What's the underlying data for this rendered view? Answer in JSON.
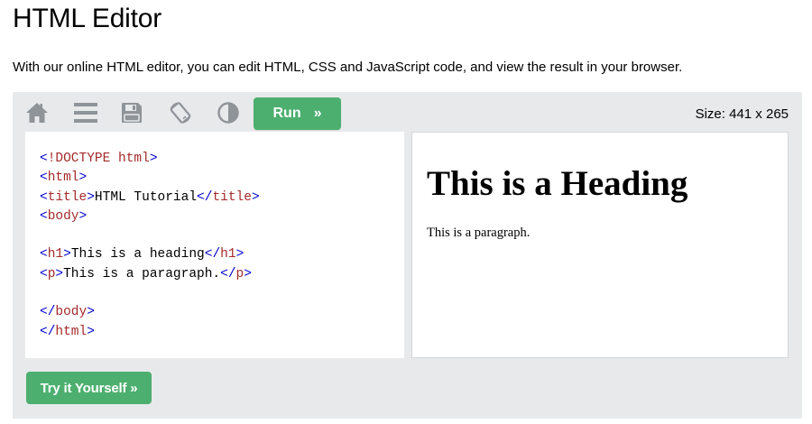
{
  "page": {
    "title": "HTML Editor",
    "intro": "With our online HTML editor, you can edit HTML, CSS and JavaScript code, and view the result in your browser."
  },
  "toolbar": {
    "icons": [
      "home-icon",
      "menu-icon",
      "save-icon",
      "rotate-icon",
      "contrast-icon"
    ],
    "run_label": "Run",
    "run_arrow": "»",
    "size_readout": "Size: 441 x 265"
  },
  "code": {
    "lines": [
      [
        {
          "t": "tag",
          "v": "<"
        },
        {
          "t": "tname",
          "v": "!DOCTYPE html"
        },
        {
          "t": "tag",
          "v": ">"
        }
      ],
      [
        {
          "t": "tag",
          "v": "<"
        },
        {
          "t": "tname",
          "v": "html"
        },
        {
          "t": "tag",
          "v": ">"
        }
      ],
      [
        {
          "t": "tag",
          "v": "<"
        },
        {
          "t": "tname",
          "v": "title"
        },
        {
          "t": "tag",
          "v": ">"
        },
        {
          "t": "ctext",
          "v": "HTML Tutorial"
        },
        {
          "t": "tag",
          "v": "</"
        },
        {
          "t": "tname",
          "v": "title"
        },
        {
          "t": "tag",
          "v": ">"
        }
      ],
      [
        {
          "t": "tag",
          "v": "<"
        },
        {
          "t": "tname",
          "v": "body"
        },
        {
          "t": "tag",
          "v": ">"
        }
      ],
      [],
      [
        {
          "t": "tag",
          "v": "<"
        },
        {
          "t": "tname",
          "v": "h1"
        },
        {
          "t": "tag",
          "v": ">"
        },
        {
          "t": "ctext",
          "v": "This is a heading"
        },
        {
          "t": "tag",
          "v": "</"
        },
        {
          "t": "tname",
          "v": "h1"
        },
        {
          "t": "tag",
          "v": ">"
        }
      ],
      [
        {
          "t": "tag",
          "v": "<"
        },
        {
          "t": "tname",
          "v": "p"
        },
        {
          "t": "tag",
          "v": ">"
        },
        {
          "t": "ctext",
          "v": "This is a paragraph."
        },
        {
          "t": "tag",
          "v": "</"
        },
        {
          "t": "tname",
          "v": "p"
        },
        {
          "t": "tag",
          "v": ">"
        }
      ],
      [],
      [
        {
          "t": "tag",
          "v": "</"
        },
        {
          "t": "tname",
          "v": "body"
        },
        {
          "t": "tag",
          "v": ">"
        }
      ],
      [
        {
          "t": "tag",
          "v": "</"
        },
        {
          "t": "tname",
          "v": "html"
        },
        {
          "t": "tag",
          "v": ">"
        }
      ]
    ]
  },
  "result": {
    "heading": "This is a Heading",
    "paragraph": "This is a paragraph."
  },
  "actions": {
    "try_label": "Try it Yourself »"
  },
  "colors": {
    "accent_green": "#4caf6f",
    "panel_gray": "#e7e9eb",
    "icon_gray": "#8f9499",
    "code_tag": "#0000cd",
    "code_tagname": "#a52a2a"
  }
}
